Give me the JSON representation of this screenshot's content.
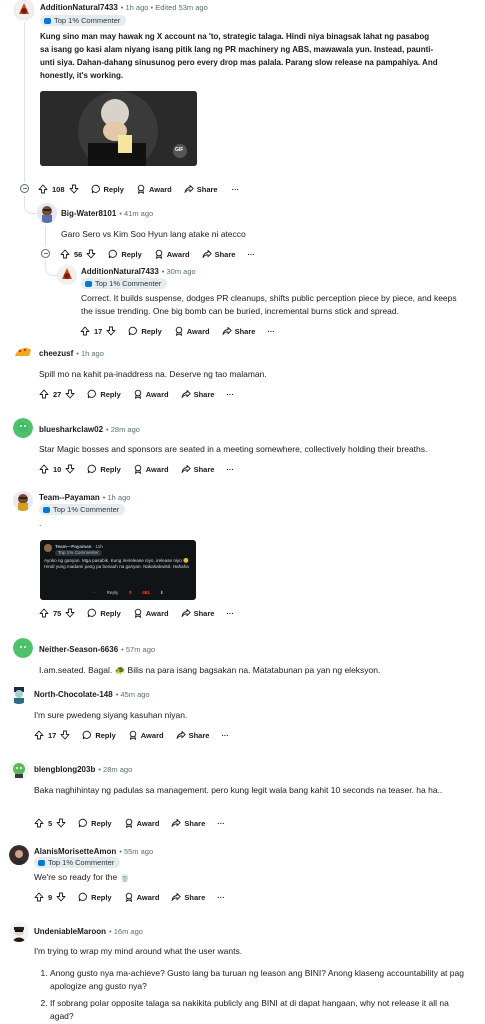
{
  "common": {
    "reply": "Reply",
    "award": "Award",
    "share": "Share",
    "more": "···",
    "flair_top": "Top 1% Commenter"
  },
  "c1": {
    "user": "AdditionNatural7433",
    "time": "• 1h ago • Edited 53m ago",
    "body": "Kung sino man may hawak ng X account na 'to, strategic talaga. Hindi niya binagsak lahat ng pasabog sa isang go kasi alam niyang isang pitik lang ng PR machinery ng ABS, mawawala yun. Instead, paunti-unti siya. Dahan-dahang sinusunog pero every drop mas palala. Parang slow release na pampahiya. And honestly, it's working.",
    "gif_badge": "GIF",
    "votes": "108"
  },
  "c2": {
    "user": "Big-Water8101",
    "time": "• 41m ago",
    "body": "Garo Sero vs Kim Soo Hyun lang atake ni atecco",
    "votes": "56"
  },
  "c3": {
    "user": "AdditionNatural7433",
    "time": "• 30m ago",
    "body": "Correct. It builds suspense, dodges PR cleanups, shifts public perception piece by piece, and keeps the issue trending. One big bomb can be buried, incremental burns stick and spread.",
    "votes": "17"
  },
  "c4": {
    "user": "cheezusf",
    "time": "• 1h ago",
    "body": "Spill mo na kahit pa-inaddress na. Deserve ng tao malaman.",
    "votes": "27"
  },
  "c5": {
    "user": "bluesharkclaw02",
    "time": "• 28m ago",
    "body": "Star Magic bosses and sponsors are seated in a meeting somewhere, collectively holding their breaths.",
    "votes": "10"
  },
  "c6": {
    "user": "Team--Payaman",
    "time": "• 1h ago",
    "body": ".",
    "votes": "75",
    "shot": {
      "user": "Team—Payaman",
      "time": "· 11h",
      "flair": "Top 1% Commenter",
      "text": "Ayoko ng ganyan. Mga pasabik. Kung ireirelease niyo, irelease niyo 😊 Hindi yung madami pang pa bonauh na ganyan. Nakakabwisit. Hahaha",
      "reply": "Reply",
      "votes": "481"
    }
  },
  "c7": {
    "user": "Neither-Season-6636",
    "time": "• 57m ago",
    "body": "I.am.seated. Bagal. 🐢 Bilis na para isang bagsakan na. Matatabunan pa yan ng eleksyon."
  },
  "c8": {
    "user": "North-Chocolate-148",
    "time": "• 45m ago",
    "body": "I'm sure pwedeng siyang kasuhan niyan.",
    "votes": "17"
  },
  "c9": {
    "user": "blengblong203b",
    "time": "• 28m ago",
    "body": "Baka naghihintay ng padulas sa management. pero kung legit wala bang kahit 10 seconds na teaser. ha ha..",
    "votes": "5"
  },
  "c10": {
    "user": "AlanisMorisetteAmon",
    "time": "• 55m ago",
    "body": "We're so ready for the 🍵",
    "votes": "9"
  },
  "c11": {
    "user": "UndeniableMaroon",
    "time": "• 16m ago",
    "body": "I'm trying to wrap my mind around what the user wants.",
    "list": [
      "Anong gusto nya ma-achieve? Gusto lang ba turuan ng leason ang BINI? Anong klaseng accountability at pag apologize ang gusto nya?",
      "If sobrang polar opposite talaga sa nakikita publicly ang BINI at di dapat hangaan, why not release it all na agad?"
    ]
  },
  "colors": {
    "meta": "#576f76",
    "flair_bg": "#e5ebee",
    "thread": "#dde3e6",
    "upvote_active": "#d93900"
  }
}
